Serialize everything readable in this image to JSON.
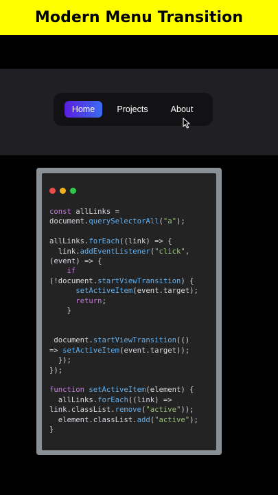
{
  "banner": {
    "title": "Modern Menu Transition"
  },
  "nav": {
    "items": [
      {
        "label": "Home",
        "active": true
      },
      {
        "label": "Projects",
        "active": false
      },
      {
        "label": "About",
        "active": false
      }
    ]
  },
  "colors": {
    "banner_bg": "#ffff00",
    "band_bg": "#1f1f24",
    "pill_bg": "#121214",
    "active_gradient_start": "#5b1ee0",
    "active_gradient_end": "#3b6cf0",
    "code_bg": "#232323",
    "frame": "#8a9196",
    "dot_red": "#ef4d4d",
    "dot_yellow": "#f3b21e",
    "dot_green": "#2fcb4d"
  },
  "icons": {
    "cursor": "mouse-pointer-icon"
  },
  "code": {
    "lines": [
      [
        {
          "t": "const ",
          "c": "kw"
        },
        {
          "t": "allLinks =",
          "c": "plain"
        }
      ],
      [
        {
          "t": "document.",
          "c": "plain"
        },
        {
          "t": "querySelectorAll",
          "c": "fn"
        },
        {
          "t": "(",
          "c": "plain"
        },
        {
          "t": "\"a\"",
          "c": "str"
        },
        {
          "t": ");",
          "c": "plain"
        }
      ],
      [],
      [
        {
          "t": "allLinks.",
          "c": "plain"
        },
        {
          "t": "forEach",
          "c": "fn"
        },
        {
          "t": "((link) => {",
          "c": "plain"
        }
      ],
      [
        {
          "t": "  link.",
          "c": "plain"
        },
        {
          "t": "addEventListener",
          "c": "fn"
        },
        {
          "t": "(",
          "c": "plain"
        },
        {
          "t": "\"click\"",
          "c": "str"
        },
        {
          "t": ",",
          "c": "plain"
        }
      ],
      [
        {
          "t": "(event) => {",
          "c": "plain"
        }
      ],
      [
        {
          "t": "    ",
          "c": "plain"
        },
        {
          "t": "if",
          "c": "kw"
        }
      ],
      [
        {
          "t": "(!document.",
          "c": "plain"
        },
        {
          "t": "startViewTransition",
          "c": "fn"
        },
        {
          "t": ") {",
          "c": "plain"
        }
      ],
      [
        {
          "t": "      ",
          "c": "plain"
        },
        {
          "t": "setActiveItem",
          "c": "fn"
        },
        {
          "t": "(event.target);",
          "c": "plain"
        }
      ],
      [
        {
          "t": "      ",
          "c": "plain"
        },
        {
          "t": "return",
          "c": "kw"
        },
        {
          "t": ";",
          "c": "plain"
        }
      ],
      [
        {
          "t": "    }",
          "c": "plain"
        }
      ],
      [],
      [],
      [
        {
          "t": " document.",
          "c": "plain"
        },
        {
          "t": "startViewTransition",
          "c": "fn"
        },
        {
          "t": "(()",
          "c": "plain"
        }
      ],
      [
        {
          "t": "=> ",
          "c": "plain"
        },
        {
          "t": "setActiveItem",
          "c": "fn"
        },
        {
          "t": "(event.target));",
          "c": "plain"
        }
      ],
      [
        {
          "t": "  });",
          "c": "plain"
        }
      ],
      [
        {
          "t": "});",
          "c": "plain"
        }
      ],
      [],
      [
        {
          "t": "function ",
          "c": "kw"
        },
        {
          "t": "setActiveItem",
          "c": "fn"
        },
        {
          "t": "(element) {",
          "c": "plain"
        }
      ],
      [
        {
          "t": "  allLinks.",
          "c": "plain"
        },
        {
          "t": "forEach",
          "c": "fn"
        },
        {
          "t": "((link) =>",
          "c": "plain"
        }
      ],
      [
        {
          "t": "link.classList.",
          "c": "plain"
        },
        {
          "t": "remove",
          "c": "fn"
        },
        {
          "t": "(",
          "c": "plain"
        },
        {
          "t": "\"active\"",
          "c": "str"
        },
        {
          "t": "));",
          "c": "plain"
        }
      ],
      [
        {
          "t": "  element.classList.",
          "c": "plain"
        },
        {
          "t": "add",
          "c": "fn"
        },
        {
          "t": "(",
          "c": "plain"
        },
        {
          "t": "\"active\"",
          "c": "str"
        },
        {
          "t": ");",
          "c": "plain"
        }
      ],
      [
        {
          "t": "}",
          "c": "plain"
        }
      ]
    ]
  }
}
